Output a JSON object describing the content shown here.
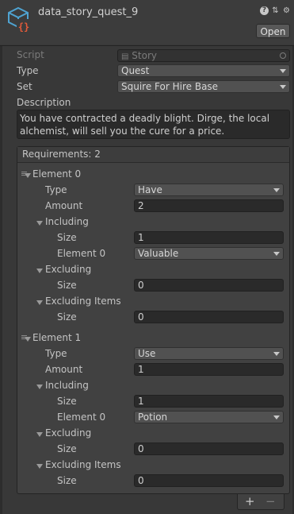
{
  "header": {
    "title": "data_story_quest_9",
    "open_label": "Open",
    "icons": [
      "help-icon",
      "presets-icon",
      "gear-icon"
    ]
  },
  "fields": {
    "script_label": "Script",
    "script_value": "Story",
    "type_label": "Type",
    "type_value": "Quest",
    "set_label": "Set",
    "set_value": "Squire For Hire Base",
    "description_label": "Description",
    "description_value": "You have contracted a deadly blight. Dirge, the local alchemist, will sell you the cure for a price."
  },
  "requirements": {
    "header": "Requirements: 2",
    "elements": [
      {
        "label": "Element 0",
        "type_label": "Type",
        "type_value": "Have",
        "amount_label": "Amount",
        "amount_value": "2",
        "including_label": "Including",
        "including_size_label": "Size",
        "including_size_value": "1",
        "including_el_label": "Element 0",
        "including_el_value": "Valuable",
        "excluding_label": "Excluding",
        "excluding_size_label": "Size",
        "excluding_size_value": "0",
        "excluding_items_label": "Excluding Items",
        "excluding_items_size_label": "Size",
        "excluding_items_size_value": "0"
      },
      {
        "label": "Element 1",
        "type_label": "Type",
        "type_value": "Use",
        "amount_label": "Amount",
        "amount_value": "1",
        "including_label": "Including",
        "including_size_label": "Size",
        "including_size_value": "1",
        "including_el_label": "Element 0",
        "including_el_value": "Potion",
        "excluding_label": "Excluding",
        "excluding_size_label": "Size",
        "excluding_size_value": "0",
        "excluding_items_label": "Excluding Items",
        "excluding_items_size_label": "Size",
        "excluding_items_size_value": "0"
      }
    ],
    "add_label": "+",
    "remove_label": "−"
  },
  "colors": {
    "background": "#383838",
    "field": "#2a2a2a",
    "dropdown": "#515151",
    "icon_blue": "#4fa3d1",
    "icon_red": "#e25a3a"
  }
}
